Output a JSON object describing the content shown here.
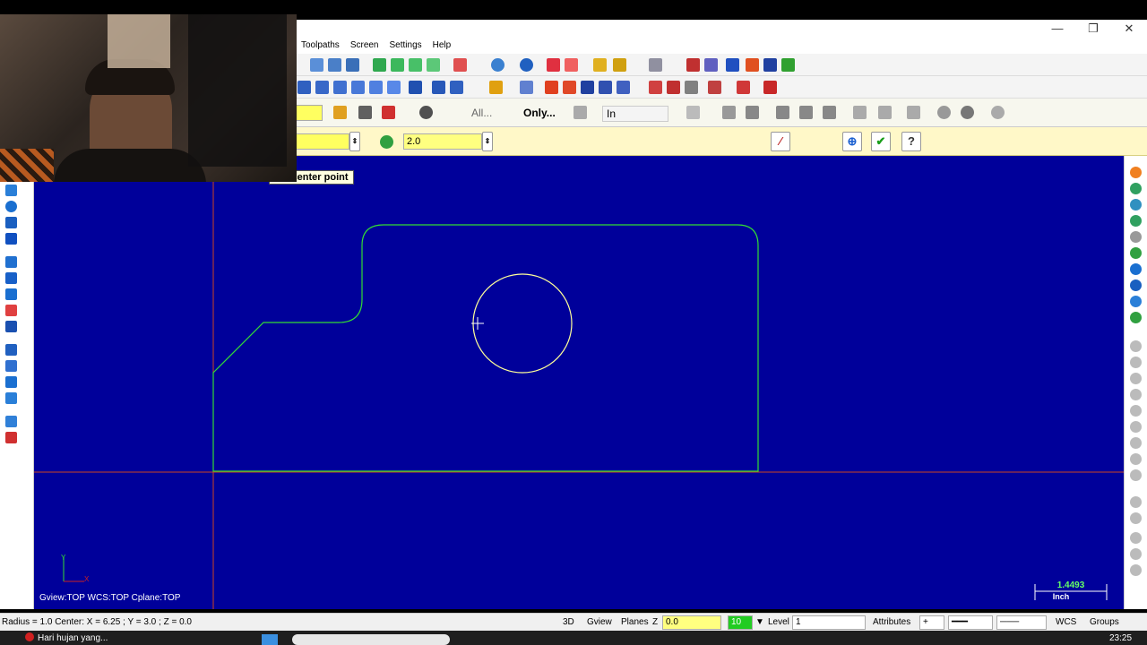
{
  "window": {
    "minimize": "—",
    "restore": "❐",
    "close": "✕"
  },
  "menu": [
    "Toolpaths",
    "Screen",
    "Settings",
    "Help"
  ],
  "ribbon3": {
    "all_label": "All...",
    "only_label": "Only...",
    "units_value": "In"
  },
  "ribbon": {
    "radius_value": "2.0"
  },
  "tooltip": "the center point",
  "viewport": {
    "view_info": "Gview:TOP   WCS:TOP   Cplane:TOP",
    "axis_y": "Y",
    "axis_x": "X",
    "scale_value": "1.4493",
    "scale_unit": "Inch"
  },
  "status": {
    "coords": "Radius = 1.0 Center: X = 6.25 ; Y = 3.0 ; Z = 0.0",
    "3d": "3D",
    "gview": "Gview",
    "planes": "Planes",
    "z_label": "Z",
    "z_value": "0.0",
    "color_value": "10",
    "level_label": "Level",
    "level_value": "1",
    "attributes": "Attributes",
    "wcs": "WCS",
    "groups": "Groups"
  },
  "taskbar": {
    "weather": "Hari hujan yang...",
    "time": "23:25"
  },
  "colors": {
    "canvas": "#00009a",
    "geometry": "#33dd33",
    "circle": "#ffff99",
    "axis": "#cc4422"
  }
}
